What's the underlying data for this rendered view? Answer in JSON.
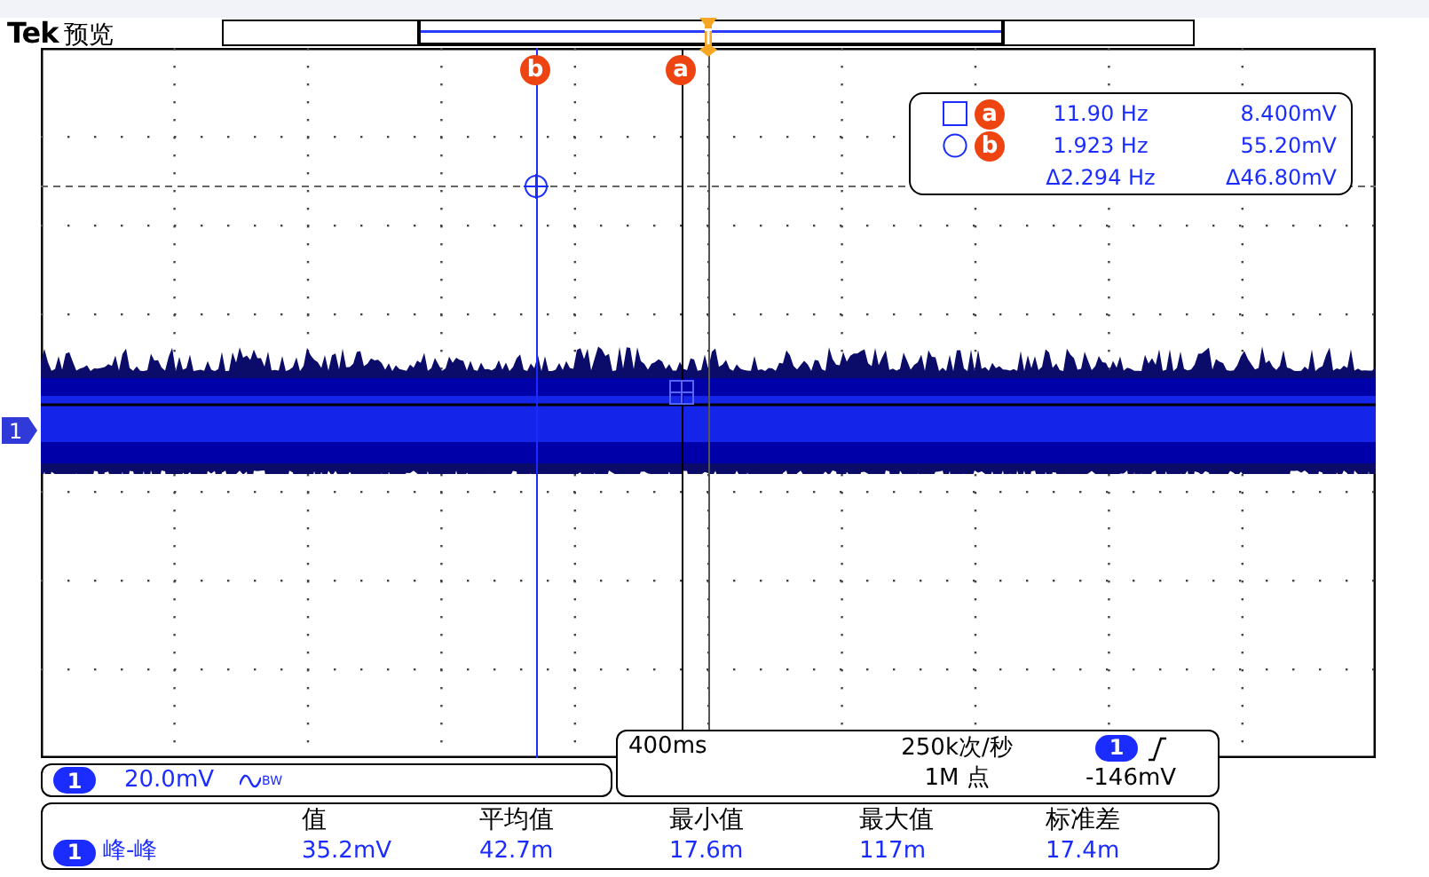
{
  "header": {
    "brand": "Tek",
    "mode": "预览"
  },
  "cursors": [
    {
      "label": "b",
      "kind": "circle"
    },
    {
      "label": "a",
      "kind": "square"
    }
  ],
  "readout": [
    {
      "label": "a",
      "kind": "square",
      "freq": "11.90 Hz",
      "volt": "8.400mV"
    },
    {
      "label": "b",
      "kind": "circle",
      "freq": "1.923 Hz",
      "volt": "55.20mV"
    }
  ],
  "delta": {
    "freq": "Δ2.294 Hz",
    "volt": "Δ46.80mV"
  },
  "channel_marker": "1",
  "channel": {
    "number": "1",
    "scale": "20.0mV",
    "bw": "BW"
  },
  "timebase": {
    "time": "400ms",
    "rate": "250k次/秒",
    "points": "1M 点",
    "trigger_source": "1",
    "trigger_level": "-146mV"
  },
  "measurements": {
    "headers": [
      "值",
      "平均值",
      "最小值",
      "最大值",
      "标准差"
    ],
    "rows": [
      {
        "channel": "1",
        "name": "峰-峰",
        "values": [
          "35.2mV",
          "42.7m",
          "17.6m",
          "117m",
          "17.4m"
        ]
      }
    ]
  }
}
